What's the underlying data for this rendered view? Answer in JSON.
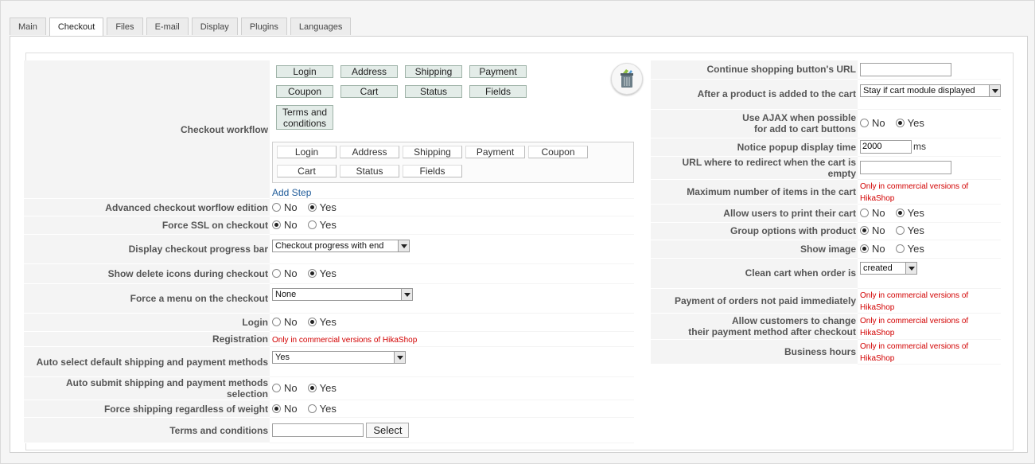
{
  "tabs": [
    "Main",
    "Checkout",
    "Files",
    "E-mail",
    "Display",
    "Plugins",
    "Languages"
  ],
  "active_tab": "Checkout",
  "workflow": {
    "label": "Checkout workflow",
    "steps_row1": [
      "Login",
      "Address",
      "Shipping",
      "Payment"
    ],
    "steps_row2": [
      "Coupon",
      "Cart",
      "Status",
      "Fields"
    ],
    "steps_row3": [
      "Terms and conditions"
    ],
    "available_row1": [
      "Login",
      "Address",
      "Shipping",
      "Payment",
      "Coupon"
    ],
    "available_row2": [
      "Cart",
      "Status",
      "Fields"
    ],
    "add_step": "Add Step",
    "trash_icon": "trash-icon"
  },
  "left": {
    "advanced": {
      "label": "Advanced checkout worflow edition",
      "no": "No",
      "yes": "Yes",
      "value": "yes"
    },
    "force_ssl": {
      "label": "Force SSL on checkout",
      "no": "No",
      "yes": "Yes",
      "value": "no"
    },
    "progress_bar": {
      "label": "Display checkout progress bar",
      "value": "Checkout progress with end"
    },
    "delete_icons": {
      "label": "Show delete icons during checkout",
      "no": "No",
      "yes": "Yes",
      "value": "yes"
    },
    "force_menu": {
      "label": "Force a menu on the checkout",
      "value": "None"
    },
    "login": {
      "label": "Login",
      "no": "No",
      "yes": "Yes",
      "value": "yes"
    },
    "registration": {
      "label": "Registration",
      "note": "Only in commercial versions of HikaShop"
    },
    "auto_select": {
      "label": "Auto select default shipping and payment methods",
      "value": "Yes"
    },
    "auto_submit": {
      "label": "Auto submit shipping and payment methods selection",
      "no": "No",
      "yes": "Yes",
      "value": "yes"
    },
    "force_shipping": {
      "label": "Force shipping regardless of weight",
      "no": "No",
      "yes": "Yes",
      "value": "no"
    },
    "terms": {
      "label": "Terms and conditions",
      "value": "",
      "button": "Select"
    }
  },
  "right": {
    "continue_url": {
      "label": "Continue shopping button's URL",
      "value": ""
    },
    "after_add": {
      "label": "After a product is added to the cart",
      "value": "Stay if cart module displayed"
    },
    "use_ajax": {
      "label1": "Use AJAX when possible",
      "label2": "for add to cart buttons",
      "no": "No",
      "yes": "Yes",
      "value": "yes"
    },
    "popup_time": {
      "label": "Notice popup display time",
      "value": "2000",
      "unit": "ms"
    },
    "redirect_url": {
      "label": "URL where to redirect when the cart is empty",
      "value": ""
    },
    "max_items": {
      "label": "Maximum number of items in the cart",
      "note1": "Only in commercial versions of",
      "note2": "HikaShop"
    },
    "print_cart": {
      "label": "Allow users to print their cart",
      "no": "No",
      "yes": "Yes",
      "value": "yes"
    },
    "group_options": {
      "label": "Group options with product",
      "no": "No",
      "yes": "Yes",
      "value": "no"
    },
    "show_image": {
      "label": "Show image",
      "no": "No",
      "yes": "Yes",
      "value": "no"
    },
    "clean_cart": {
      "label": "Clean cart when order is",
      "value": "created"
    },
    "payment_not_paid": {
      "label": "Payment of orders not paid immediately",
      "note1": "Only in commercial versions of",
      "note2": "HikaShop"
    },
    "change_payment": {
      "label1": "Allow customers to change",
      "label2": "their payment method after checkout",
      "note1": "Only in commercial versions of",
      "note2": "HikaShop"
    },
    "business_hours": {
      "label": "Business hours",
      "note1": "Only in commercial versions of",
      "note2": "HikaShop"
    }
  }
}
